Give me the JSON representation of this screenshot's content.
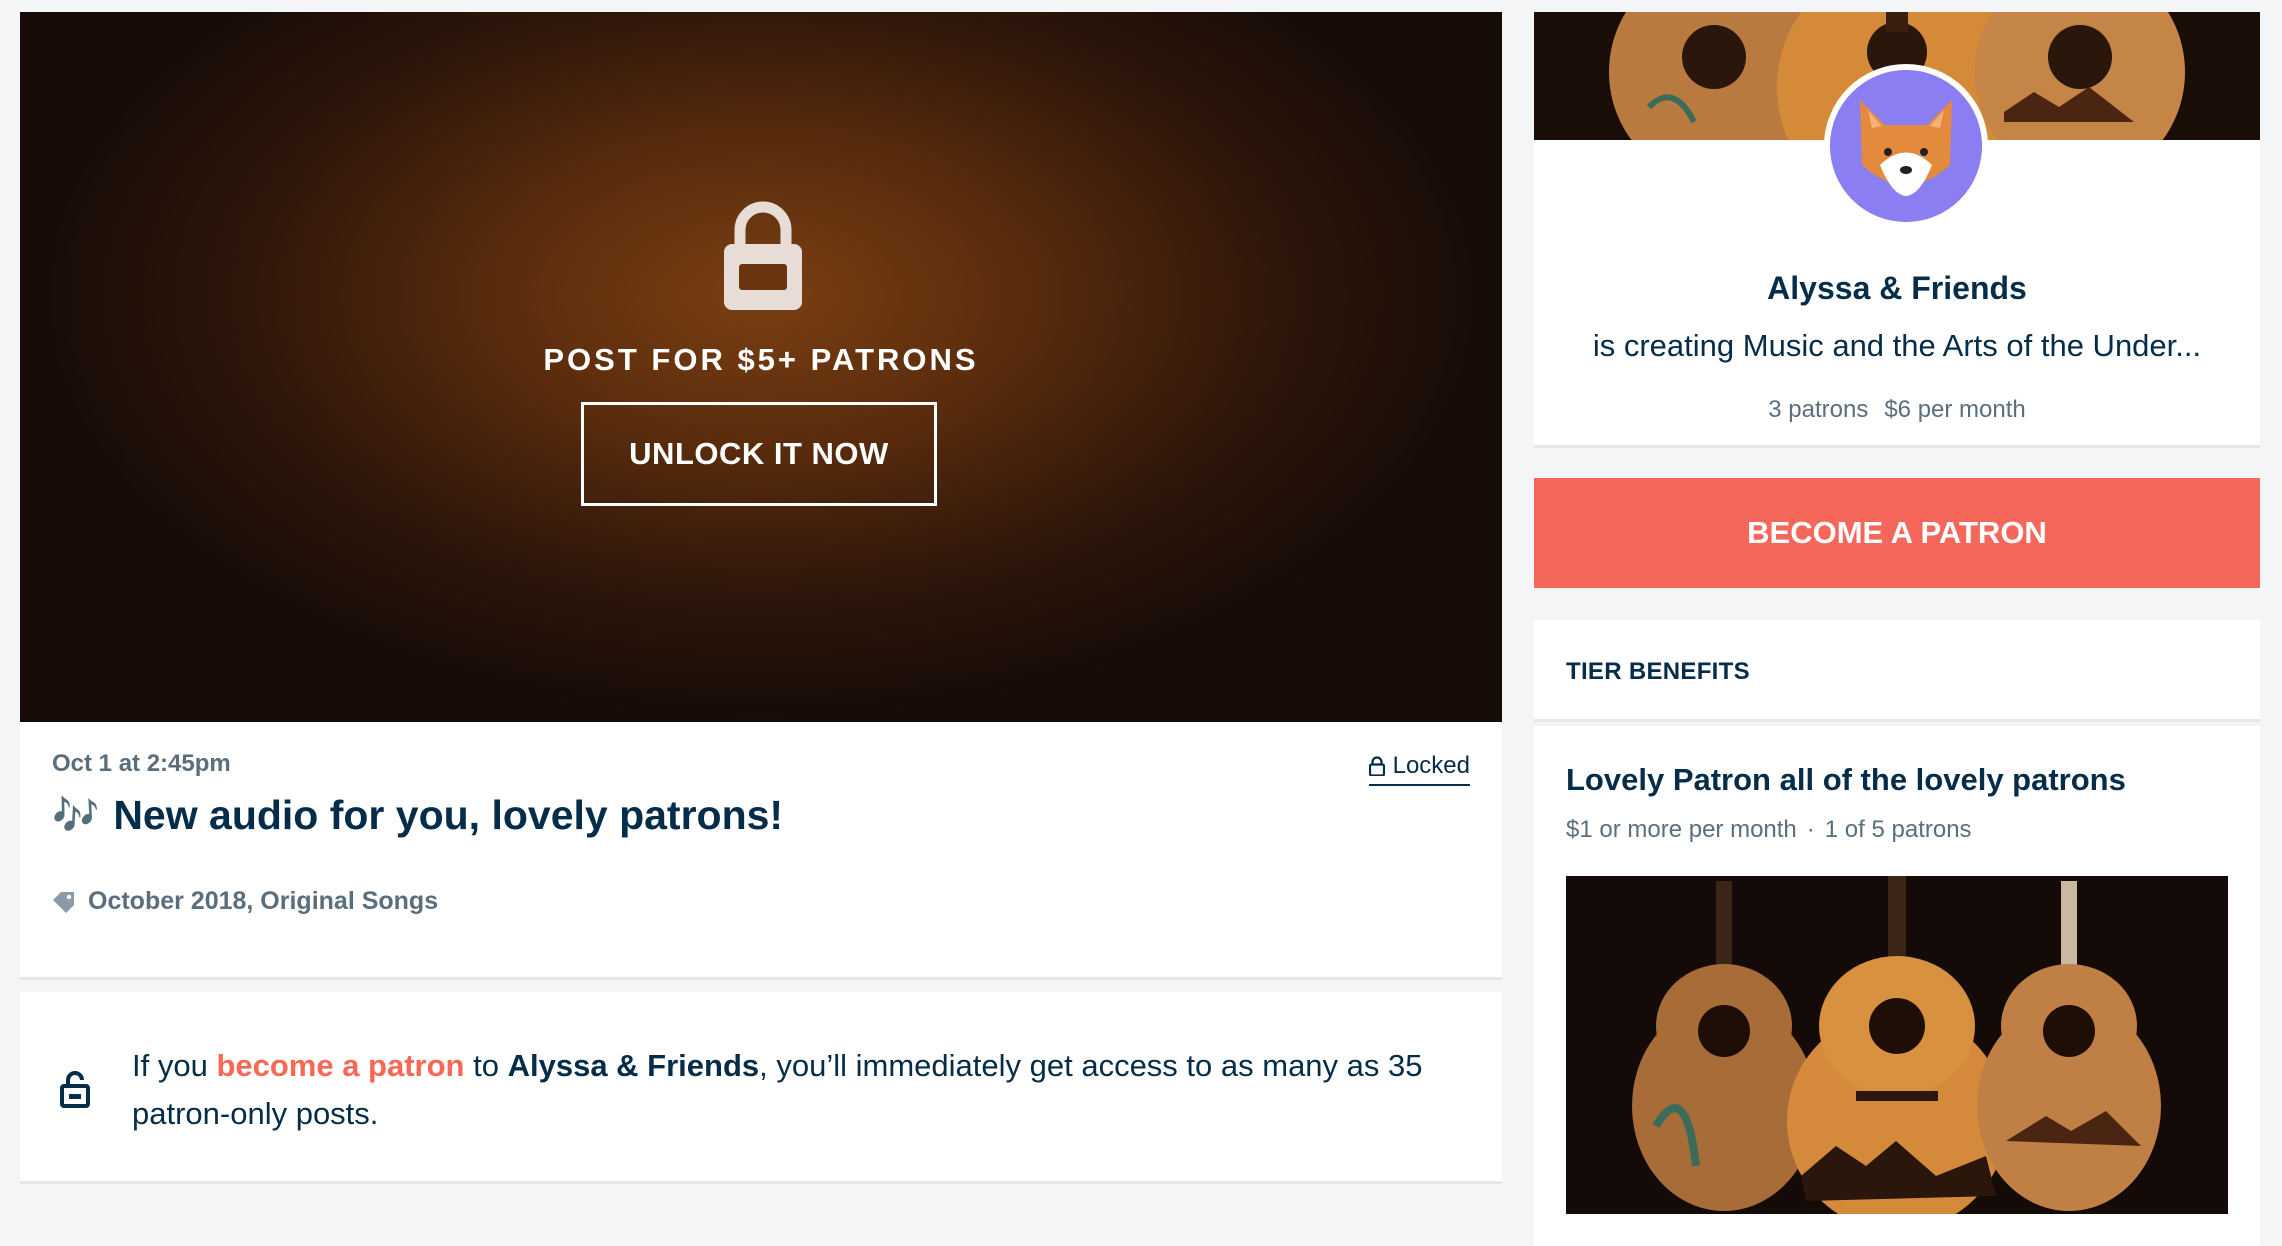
{
  "post": {
    "hero_title": "POST FOR $5+ PATRONS",
    "unlock_label": "UNLOCK IT NOW",
    "date": "Oct 1 at 2:45pm",
    "locked_label": "Locked",
    "title_emoji": "🎶",
    "title": "New audio for you, lovely patrons!",
    "tags": "October 2018, Original Songs"
  },
  "info": {
    "prefix": "If you ",
    "link": "become a patron",
    "middle": " to ",
    "creator": "Alyssa & Friends",
    "suffix": ", you’ll immediately get access to as many as 35 patron-only posts."
  },
  "creator": {
    "name": "Alyssa & Friends",
    "description": "is creating Music and the Arts of the Under...",
    "patrons": "3 patrons",
    "per_month": "$6 per month"
  },
  "cta": {
    "become_label": "BECOME A PATRON"
  },
  "tier": {
    "header": "TIER BENEFITS",
    "name": "Lovely Patron all of the lovely patrons",
    "price": "$1 or more per month",
    "count": "1 of 5 patrons"
  },
  "colors": {
    "accent": "#f96854",
    "text": "#052d49",
    "muted": "#5b6e7e"
  }
}
